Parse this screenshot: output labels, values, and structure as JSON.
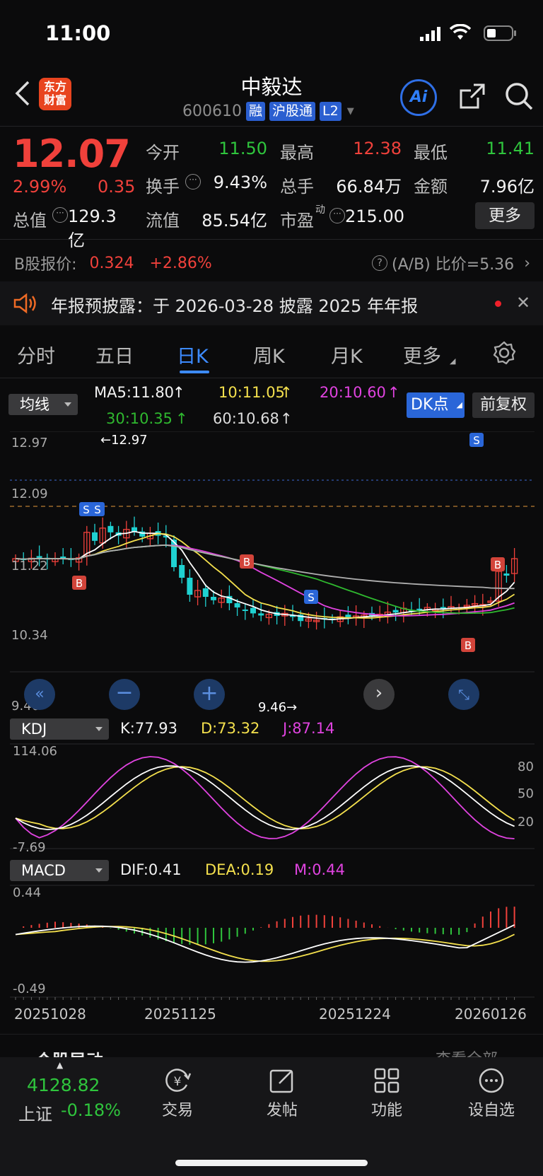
{
  "status_bar": {
    "time": "11:00"
  },
  "header": {
    "logo_text": "东方\n财富",
    "stock_name": "中毅达",
    "stock_code": "600610",
    "tags": [
      "融",
      "沪股通",
      "L2"
    ],
    "ai_label": "Ai"
  },
  "quote": {
    "price": "12.07",
    "change_pct": "2.99%",
    "change": "0.35",
    "fields": [
      {
        "label": "今开",
        "value": "11.50",
        "color": "green"
      },
      {
        "label": "最高",
        "value": "12.38",
        "color": "red"
      },
      {
        "label": "最低",
        "value": "11.41",
        "color": "green"
      },
      {
        "label": "换手",
        "value": "9.43%",
        "color": "white"
      },
      {
        "label": "总手",
        "value": "66.84万",
        "color": "white"
      },
      {
        "label": "金额",
        "value": "7.96亿",
        "color": "white"
      },
      {
        "label": "总值",
        "value": "129.3亿",
        "color": "white"
      },
      {
        "label": "流值",
        "value": "85.54亿",
        "color": "white"
      },
      {
        "label": "市盈",
        "value": "215.00",
        "color": "white"
      }
    ],
    "pe_superscript": "动",
    "more_label": "更多"
  },
  "b_share": {
    "label": "B股报价:",
    "price": "0.324",
    "pct": "+2.86%",
    "ratio_label": "(A/B) 比价=5.36"
  },
  "notice": {
    "text": "年报预披露：于 2026-03-28 披露 2025 年年报"
  },
  "tabs": [
    "分时",
    "五日",
    "日K",
    "周K",
    "月K",
    "更多"
  ],
  "active_tab": "日K",
  "main_chart": {
    "indicator": "均线",
    "ma5": "MA5:11.80",
    "ma10": "10:11.05",
    "ma20": "20:10.60",
    "ma30": "30:10.35",
    "ma60": "60:10.68",
    "dk_label": "DK点",
    "adjust_label": "前复权",
    "y_labels": [
      "12.97",
      "12.09",
      "11.22",
      "10.34",
      "9.46"
    ],
    "high_marker": "←12.97",
    "low_marker": "9.46→"
  },
  "kdj": {
    "name": "KDJ",
    "k": "K:77.93",
    "d": "D:73.32",
    "j": "J:87.14",
    "y_top": "114.06",
    "y_bottom": "-7.69",
    "levels": [
      "80",
      "50",
      "20"
    ]
  },
  "macd": {
    "name": "MACD",
    "dif": "DIF:0.41",
    "dea": "DEA:0.19",
    "m": "M:0.44",
    "y_top": "0.44",
    "y_bottom": "-0.49"
  },
  "x_dates": [
    "20251028",
    "20251125",
    "20251224",
    "20260126"
  ],
  "section_peek": {
    "left": "个股异动",
    "right": "查看全部"
  },
  "bottom_nav": {
    "index_value": "4128.82",
    "index_name": "上证",
    "index_pct": "-0.18%",
    "items": [
      "交易",
      "发帖",
      "功能",
      "设自选"
    ]
  },
  "colors": {
    "up": "#f0413b",
    "down": "#1fd1d1",
    "ma5": "#ffffff",
    "ma10": "#f4e04d",
    "ma20": "#e043e0",
    "ma30": "#2fb82f",
    "ma60": "#b0b0b0",
    "accent": "#2f6fe6"
  }
}
